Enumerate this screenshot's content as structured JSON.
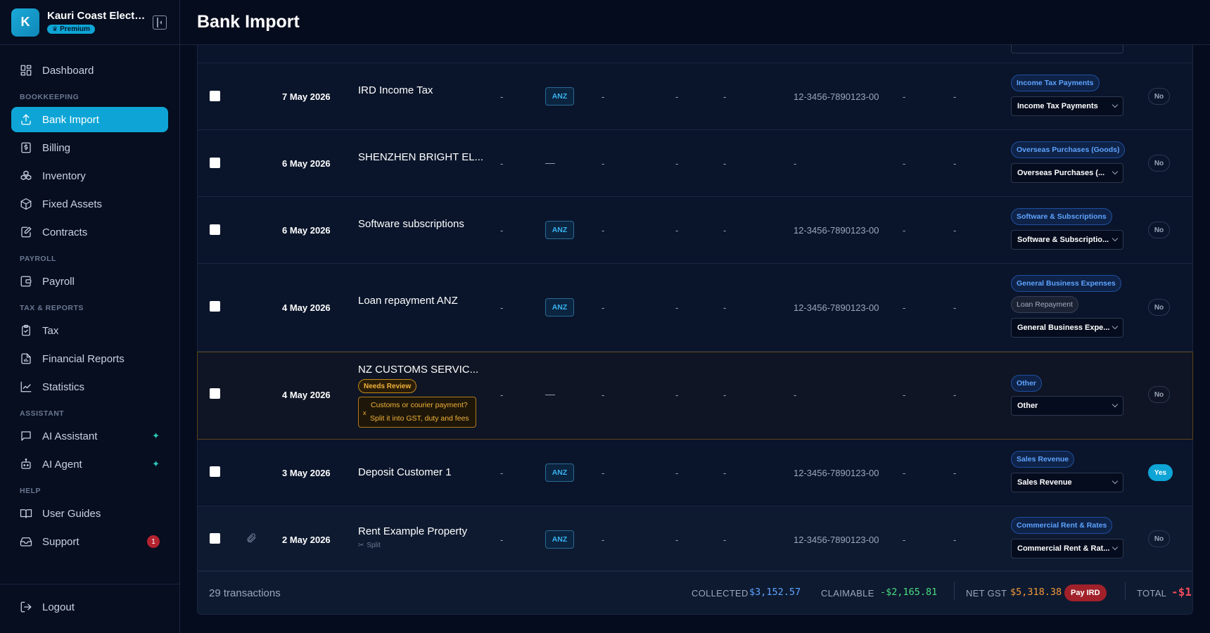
{
  "brand": {
    "initial": "K",
    "name": "Kauri Coast Electri...",
    "plan": "Premium"
  },
  "nav": {
    "dashboard": "Dashboard",
    "section_bookkeeping": "BOOKKEEPING",
    "bank_import": "Bank Import",
    "billing": "Billing",
    "inventory": "Inventory",
    "fixed_assets": "Fixed Assets",
    "contracts": "Contracts",
    "section_payroll": "PAYROLL",
    "payroll": "Payroll",
    "section_tax": "TAX & REPORTS",
    "tax": "Tax",
    "financial_reports": "Financial Reports",
    "statistics": "Statistics",
    "section_assistant": "ASSISTANT",
    "ai_assistant": "AI Assistant",
    "ai_agent": "AI Agent",
    "section_help": "HELP",
    "user_guides": "User Guides",
    "support": "Support",
    "support_badge": "1",
    "logout": "Logout"
  },
  "header": {
    "title": "Bank Import"
  },
  "rows": [
    {
      "date": "7 May 2026",
      "description": "IRD Income Tax",
      "dash": "-",
      "bank": "ANZ",
      "account": "12-3456-7890123-00",
      "category_pill": "Income Tax Payments",
      "category_select": "Income Tax Payments",
      "gst": "No"
    },
    {
      "date": "6 May 2026",
      "description": "SHENZHEN BRIGHT EL...",
      "dash": "-",
      "bank_empty": "—",
      "account": "-",
      "category_pill": "Overseas Purchases (Goods)",
      "category_select": "Overseas Purchases (...",
      "gst": "No"
    },
    {
      "date": "6 May 2026",
      "description": "Software subscriptions",
      "dash": "-",
      "bank": "ANZ",
      "account": "12-3456-7890123-00",
      "category_pill": "Software & Subscriptions",
      "category_select": "Software & Subscriptio...",
      "gst": "No"
    },
    {
      "date": "4 May 2026",
      "description": "Loan repayment ANZ",
      "dash": "-",
      "bank": "ANZ",
      "account": "12-3456-7890123-00",
      "category_pill": "General Business Expenses",
      "category_pill_secondary": "Loan Repayment",
      "category_select": "General Business Expe...",
      "gst": "No"
    },
    {
      "date": "4 May 2026",
      "description": "NZ CUSTOMS SERVIC...",
      "review_badge": "Needs Review",
      "hint_close": "x",
      "hint_line1": "Customs or courier payment?",
      "hint_line2": "Split it into GST, duty and fees",
      "dash": "-",
      "bank_empty": "—",
      "account": "-",
      "category_pill": "Other",
      "category_select": "Other",
      "gst": "No"
    },
    {
      "date": "3 May 2026",
      "description": "Deposit Customer 1",
      "dash": "-",
      "bank": "ANZ",
      "account": "12-3456-7890123-00",
      "category_pill": "Sales Revenue",
      "category_select": "Sales Revenue",
      "gst": "Yes"
    },
    {
      "date": "2 May 2026",
      "description": "Rent Example Property",
      "split_label": "Split",
      "dash": "-",
      "bank": "ANZ",
      "account": "12-3456-7890123-00",
      "category_pill": "Commercial Rent & Rates",
      "category_select": "Commercial Rent & Rat...",
      "gst": "No"
    }
  ],
  "footer": {
    "count": "29 transactions",
    "collected_label": "COLLECTED",
    "collected_value": "$3,152.57",
    "claimable_label": "CLAIMABLE",
    "claimable_value": "-$2,165.81",
    "net_gst_label": "NET GST",
    "net_gst_value": "$5,318.38",
    "pay_button": "Pay IRD",
    "total_label": "TOTAL",
    "total_value": "-$1..."
  },
  "colors": {
    "accent": "#0ea5d6",
    "warning": "#f3b23a",
    "danger": "#a1212b",
    "positive": "#4ade80",
    "info": "#5ea4ff"
  }
}
